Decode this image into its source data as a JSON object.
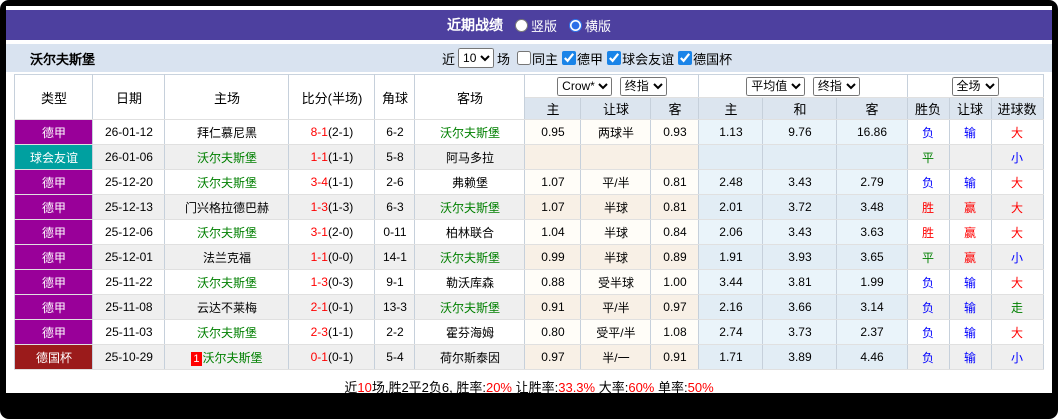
{
  "title_bar": {
    "title": "近期战绩",
    "radio_vertical_label": "竖版",
    "radio_horizontal_label": "横版",
    "vertical_checked": false,
    "horizontal_checked": true
  },
  "filter_bar": {
    "team_name": "沃尔夫斯堡",
    "prefix": "近",
    "match_count": "10",
    "suffix": "场",
    "checkboxes": [
      {
        "label": "同主",
        "checked": false
      },
      {
        "label": "德甲",
        "checked": true
      },
      {
        "label": "球会友谊",
        "checked": true
      },
      {
        "label": "德国杯",
        "checked": true
      }
    ]
  },
  "colors": {
    "title_bar_bg": "#4d409f",
    "league_dejia": "#990099",
    "league_friendly": "#00a0a0",
    "league_cup": "#9b1b1b",
    "win_red": "#ff0000",
    "draw_green": "#008000",
    "loss_blue": "#0000ff",
    "avg_col_bg": "#eaf4fa"
  },
  "table": {
    "col_headers": [
      "类型",
      "日期",
      "主场",
      "比分(半场)",
      "角球",
      "客场"
    ],
    "selects": {
      "crow_company": "Crow*",
      "crow_index_type": "终指",
      "avg_label": "平均值",
      "avg_index_type": "终指",
      "scope": "全场"
    },
    "sub_headers": [
      "主",
      "让球",
      "客",
      "主",
      "和",
      "客",
      "胜负",
      "让球",
      "进球数"
    ],
    "rows": [
      {
        "type": "德甲",
        "date": "26-01-12",
        "home": "拜仁慕尼黑",
        "home_c": "black",
        "home_badge": "",
        "score": "8-1",
        "half": "(2-1)",
        "corner": "6-2",
        "away": "沃尔夫斯堡",
        "away_c": "green",
        "ch": "0.95",
        "cl": "两球半",
        "ca": "0.93",
        "ah": "1.13",
        "ad": "9.76",
        "aa": "16.86",
        "wdl": "负",
        "wdl_c": "blue",
        "hc": "输",
        "hc_c": "blue",
        "goal": "大",
        "goal_c": "red"
      },
      {
        "type": "球会友谊",
        "date": "26-01-06",
        "home": "沃尔夫斯堡",
        "home_c": "green",
        "home_badge": "",
        "score": "1-1",
        "half": "(1-1)",
        "corner": "5-8",
        "away": "阿马多拉",
        "away_c": "black",
        "ch": "",
        "cl": "",
        "ca": "",
        "ah": "",
        "ad": "",
        "aa": "",
        "wdl": "平",
        "wdl_c": "green",
        "hc": "",
        "hc_c": "black",
        "goal": "小",
        "goal_c": "blue"
      },
      {
        "type": "德甲",
        "date": "25-12-20",
        "home": "沃尔夫斯堡",
        "home_c": "green",
        "home_badge": "",
        "score": "3-4",
        "half": "(1-1)",
        "corner": "2-6",
        "away": "弗赖堡",
        "away_c": "black",
        "ch": "1.07",
        "cl": "平/半",
        "ca": "0.81",
        "ah": "2.48",
        "ad": "3.43",
        "aa": "2.79",
        "wdl": "负",
        "wdl_c": "blue",
        "hc": "输",
        "hc_c": "blue",
        "goal": "大",
        "goal_c": "red"
      },
      {
        "type": "德甲",
        "date": "25-12-13",
        "home": "门兴格拉德巴赫",
        "home_c": "black",
        "home_badge": "",
        "score": "1-3",
        "half": "(1-3)",
        "corner": "6-3",
        "away": "沃尔夫斯堡",
        "away_c": "green",
        "ch": "1.07",
        "cl": "半球",
        "ca": "0.81",
        "ah": "2.01",
        "ad": "3.72",
        "aa": "3.48",
        "wdl": "胜",
        "wdl_c": "red",
        "hc": "赢",
        "hc_c": "red",
        "goal": "大",
        "goal_c": "red"
      },
      {
        "type": "德甲",
        "date": "25-12-06",
        "home": "沃尔夫斯堡",
        "home_c": "green",
        "home_badge": "",
        "score": "3-1",
        "half": "(2-0)",
        "corner": "0-11",
        "away": "柏林联合",
        "away_c": "black",
        "ch": "1.04",
        "cl": "半球",
        "ca": "0.84",
        "ah": "2.06",
        "ad": "3.43",
        "aa": "3.63",
        "wdl": "胜",
        "wdl_c": "red",
        "hc": "赢",
        "hc_c": "red",
        "goal": "大",
        "goal_c": "red"
      },
      {
        "type": "德甲",
        "date": "25-12-01",
        "home": "法兰克福",
        "home_c": "black",
        "home_badge": "",
        "score": "1-1",
        "half": "(0-0)",
        "corner": "14-1",
        "away": "沃尔夫斯堡",
        "away_c": "green",
        "ch": "0.99",
        "cl": "半球",
        "ca": "0.89",
        "ah": "1.91",
        "ad": "3.93",
        "aa": "3.65",
        "wdl": "平",
        "wdl_c": "green",
        "hc": "赢",
        "hc_c": "red",
        "goal": "小",
        "goal_c": "blue"
      },
      {
        "type": "德甲",
        "date": "25-11-22",
        "home": "沃尔夫斯堡",
        "home_c": "green",
        "home_badge": "",
        "score": "1-3",
        "half": "(0-3)",
        "corner": "9-1",
        "away": "勒沃库森",
        "away_c": "black",
        "ch": "0.88",
        "cl": "受半球",
        "ca": "1.00",
        "ah": "3.44",
        "ad": "3.81",
        "aa": "1.99",
        "wdl": "负",
        "wdl_c": "blue",
        "hc": "输",
        "hc_c": "blue",
        "goal": "大",
        "goal_c": "red"
      },
      {
        "type": "德甲",
        "date": "25-11-08",
        "home": "云达不莱梅",
        "home_c": "black",
        "home_badge": "",
        "score": "2-1",
        "half": "(0-1)",
        "corner": "13-3",
        "away": "沃尔夫斯堡",
        "away_c": "green",
        "ch": "0.91",
        "cl": "平/半",
        "ca": "0.97",
        "ah": "2.16",
        "ad": "3.66",
        "aa": "3.14",
        "wdl": "负",
        "wdl_c": "blue",
        "hc": "输",
        "hc_c": "blue",
        "goal": "走",
        "goal_c": "green"
      },
      {
        "type": "德甲",
        "date": "25-11-03",
        "home": "沃尔夫斯堡",
        "home_c": "green",
        "home_badge": "",
        "score": "2-3",
        "half": "(1-1)",
        "corner": "2-2",
        "away": "霍芬海姆",
        "away_c": "black",
        "ch": "0.80",
        "cl": "受平/半",
        "ca": "1.08",
        "ah": "2.74",
        "ad": "3.73",
        "aa": "2.37",
        "wdl": "负",
        "wdl_c": "blue",
        "hc": "输",
        "hc_c": "blue",
        "goal": "大",
        "goal_c": "red"
      },
      {
        "type": "德国杯",
        "date": "25-10-29",
        "home": "沃尔夫斯堡",
        "home_c": "green",
        "home_badge": "1",
        "score": "0-1",
        "half": "(0-1)",
        "corner": "5-4",
        "away": "荷尔斯泰因",
        "away_c": "black",
        "ch": "0.97",
        "cl": "半/一",
        "ca": "0.91",
        "ah": "1.71",
        "ad": "3.89",
        "aa": "4.46",
        "wdl": "负",
        "wdl_c": "blue",
        "hc": "输",
        "hc_c": "blue",
        "goal": "小",
        "goal_c": "blue"
      }
    ]
  },
  "summary": {
    "segments": [
      {
        "text": "近",
        "red": false
      },
      {
        "text": "10",
        "red": true
      },
      {
        "text": "场,胜2平2负6, 胜率:",
        "red": false
      },
      {
        "text": "20%",
        "red": true
      },
      {
        "text": " 让胜率:",
        "red": false
      },
      {
        "text": "33.3%",
        "red": true
      },
      {
        "text": " 大率:",
        "red": false
      },
      {
        "text": "60%",
        "red": true
      },
      {
        "text": " 单率:",
        "red": false
      },
      {
        "text": "50%",
        "red": true
      }
    ]
  }
}
